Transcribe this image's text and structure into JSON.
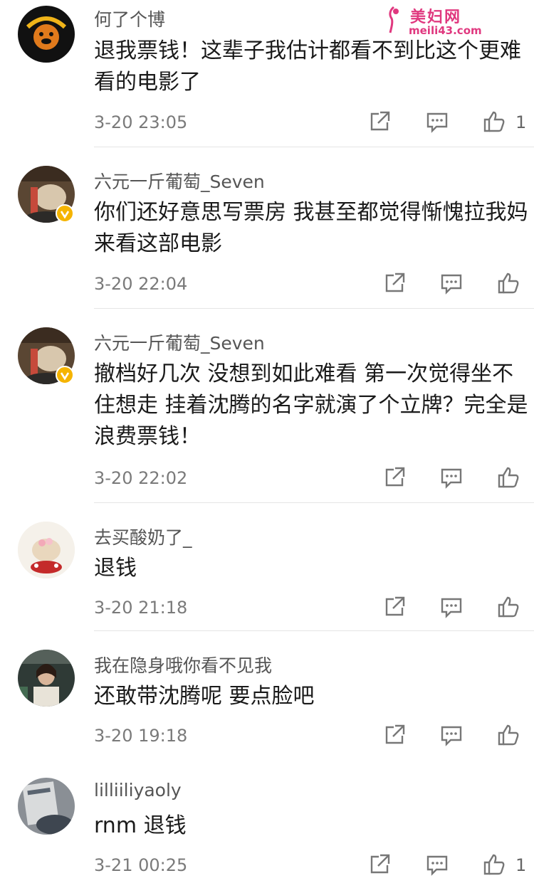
{
  "watermark": {
    "title": "美妇网",
    "url": "meili43.com"
  },
  "comments": [
    {
      "username": "何了个博",
      "avatar": "bulldog-logo-avatar",
      "text": "退我票钱！这辈子我估计都看不到比这个更难看的电影了",
      "time": "3-20 23:05",
      "likes": "1"
    },
    {
      "username": "六元一斤葡萄_Seven",
      "avatar": "photo-avatar",
      "verified": true,
      "text": "你们还好意思写票房 我甚至都觉得惭愧拉我妈来看这部电影",
      "time": "3-20 22:04",
      "likes": ""
    },
    {
      "username": "六元一斤葡萄_Seven",
      "avatar": "photo-avatar",
      "verified": true,
      "text": "撤档好几次 没想到如此难看 第一次觉得坐不住想走 挂着沈腾的名字就演了个立牌？完全是浪费票钱！",
      "time": "3-20 22:02",
      "likes": ""
    },
    {
      "username": "去买酸奶了_",
      "avatar": "cake-avatar",
      "text": "退钱",
      "time": "3-20 21:18",
      "likes": ""
    },
    {
      "username": "我在隐身哦你看不见我",
      "avatar": "photo-avatar",
      "text": "还敢带沈腾呢 要点脸吧",
      "time": "3-20 19:18",
      "likes": ""
    },
    {
      "username": "lilliiliyaoly",
      "avatar": "photo-avatar",
      "text": "rnm 退钱",
      "time": "3-21 00:25",
      "likes": "1"
    }
  ],
  "icons": {
    "share": "share-icon",
    "comment": "comment-icon",
    "like": "thumbs-up-icon"
  },
  "colors": {
    "watermark": "#e0387f",
    "verified_badge": "#f5b400"
  }
}
